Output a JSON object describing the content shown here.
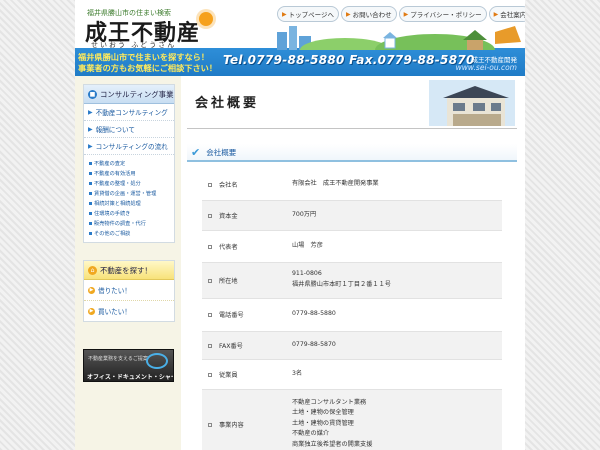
{
  "header": {
    "tagline": "福井県勝山市の住まい検索",
    "logo": "成王不動産",
    "logo_kana": "せいおう ふどうさん",
    "nav": [
      {
        "label": "トップページへ"
      },
      {
        "label": "お問い合わせ"
      },
      {
        "label": "プライバシー・ポリシー"
      },
      {
        "label": "会社案内"
      }
    ],
    "banner_line1": "福井県勝山市で住まいを探すなら！",
    "banner_line2": "事業者の方もお気軽にご相談下さい！",
    "tel_fax": "Tel.0779-88-5880  Fax.0779-88-5870",
    "company": "成王不動産開発",
    "url": "www.sei-ou.com"
  },
  "sidebar": {
    "consulting": {
      "heading": "コンサルティング事業",
      "main_items": [
        "不動産コンサルティング",
        "報酬について",
        "コンサルティングの流れ"
      ],
      "sub_items": [
        "不動産の査定",
        "不動産の有効活用",
        "不動産の整理・処分",
        "賃貸借の企画・運営・管理",
        "相続対策と相続処理",
        "住環境の手続き",
        "販売物件の調査・代行",
        "その他のご相談"
      ]
    },
    "search": {
      "heading": "不動産を探す！",
      "items": [
        "借りたい！",
        "買いたい！"
      ]
    },
    "banner": {
      "text1": "不動産業務を支えるご提案",
      "text2": "オフィス・ドキュメント・シャープ"
    }
  },
  "main": {
    "page_title": "会社概要",
    "section_title": "会社概要",
    "rows": [
      {
        "label": "会社名",
        "lines": [
          "有限会社　成王不動産開発事業"
        ]
      },
      {
        "label": "資本金",
        "lines": [
          "700万円"
        ]
      },
      {
        "label": "代表者",
        "lines": [
          "山場　芳彦"
        ]
      },
      {
        "label": "所在地",
        "lines": [
          "911-0806",
          "福井県勝山市本町１丁目２番１１号"
        ]
      },
      {
        "label": "電話番号",
        "lines": [
          "0779-88-5880"
        ]
      },
      {
        "label": "FAX番号",
        "lines": [
          "0779-88-5870"
        ]
      },
      {
        "label": "従業員",
        "lines": [
          "3名"
        ]
      },
      {
        "label": "事業内容",
        "lines": [
          "不動産コンサルタント業務",
          "土地・建物の保全管理",
          "土地・建物の賃貸管理",
          "不動産の媒介",
          "商業独立後希望者の開業支援"
        ]
      }
    ]
  },
  "colors": {
    "accent_blue": "#1f7bc6",
    "banner_yellow": "#ffea5c",
    "sidebar_bg": "#f6f4e6"
  }
}
